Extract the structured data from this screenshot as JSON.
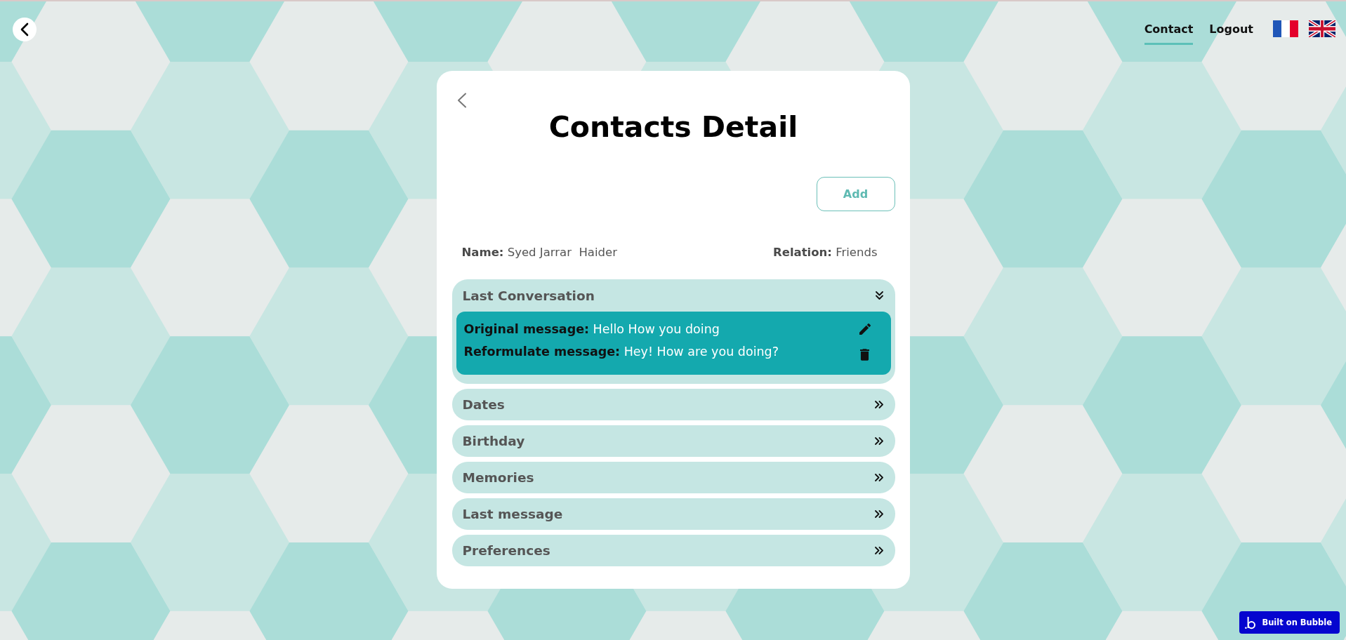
{
  "nav": [
    {
      "label": "Contact",
      "selected": true
    },
    {
      "label": "Logout",
      "selected": false
    }
  ],
  "card": {
    "title": "Contacts Detail",
    "add_button": "Add",
    "contact": {
      "name": "**Name:** Syed Jarrar  Haider",
      "relation": "**Relation:** Friends"
    },
    "sections": [
      {
        "title": "Last Conversation",
        "expanded": true,
        "entries": [
          {
            "original": "**Original message:** Hello How you doing",
            "reformulated": "**Reformulate message:** Hey! How are you doing?"
          }
        ]
      },
      {
        "title": "Dates",
        "expanded": false
      },
      {
        "title": "Birthday",
        "expanded": false
      },
      {
        "title": "Memories",
        "expanded": false
      },
      {
        "title": "Last message",
        "expanded": false
      },
      {
        "title": "Preferences",
        "expanded": false
      }
    ]
  },
  "badge": {
    "label": "Built on Bubble"
  }
}
